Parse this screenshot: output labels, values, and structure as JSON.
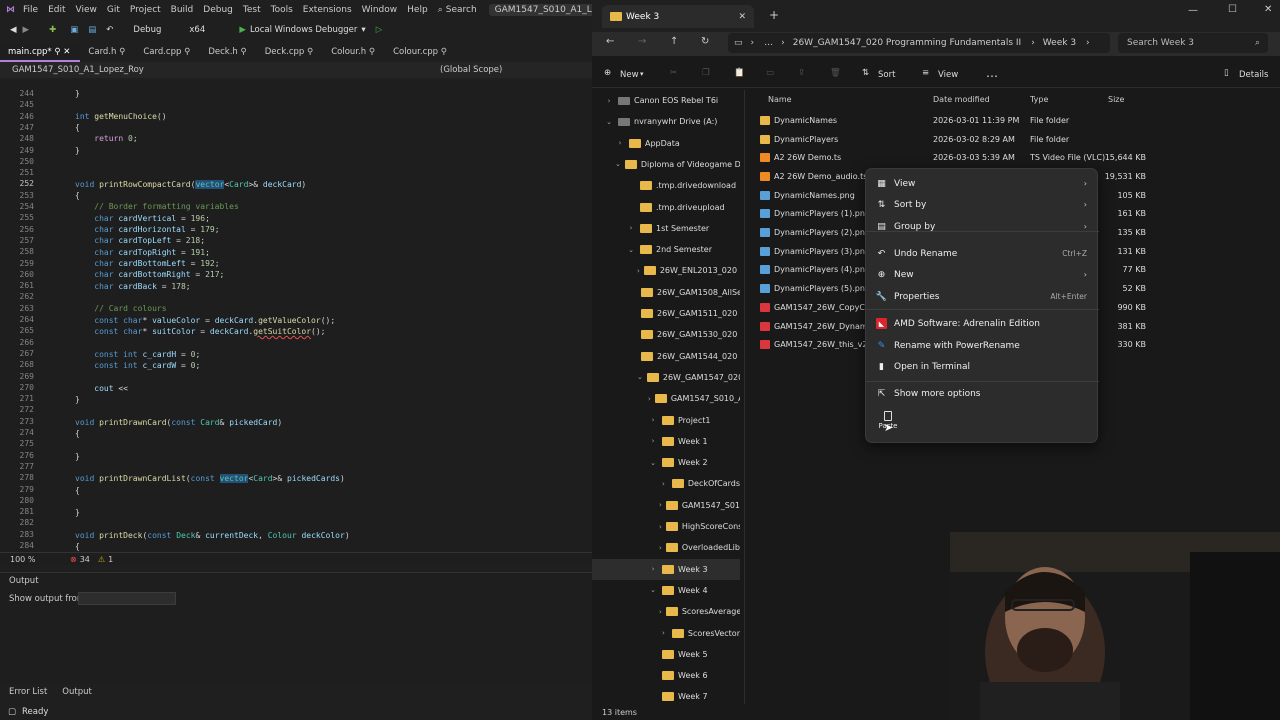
{
  "vs": {
    "menu": [
      "File",
      "Edit",
      "View",
      "Git",
      "Project",
      "Build",
      "Debug",
      "Test",
      "Tools",
      "Extensions",
      "Window",
      "Help"
    ],
    "search_label": "Search",
    "solution_name": "GAM1547_S010_A1_Lopez_Roy",
    "config": "Debug",
    "platform": "x64",
    "run_label": "Local Windows Debugger",
    "tabs": [
      "main.cpp*",
      "Card.h",
      "Card.cpp",
      "Deck.h",
      "Deck.cpp",
      "Colour.h",
      "Colour.cpp"
    ],
    "nav_project": "GAM1547_S010_A1_Lopez_Roy",
    "nav_scope": "(Global Scope)",
    "line_numbers": [
      "244",
      "245",
      "246",
      "247",
      "248",
      "249",
      "250",
      "251",
      "252",
      "253",
      "254",
      "255",
      "256",
      "257",
      "258",
      "259",
      "260",
      "261",
      "262",
      "263",
      "264",
      "265",
      "266",
      "267",
      "268",
      "269",
      "270",
      "271",
      "272",
      "273",
      "274",
      "275",
      "276",
      "277",
      "278",
      "279",
      "280",
      "281",
      "282",
      "283",
      "284"
    ],
    "zoom": "100 %",
    "errors": "34",
    "warnings": "1",
    "output_title": "Output",
    "output_from_label": "Show output from:",
    "bottom_tabs": [
      "Error List",
      "Output"
    ],
    "status": "Ready"
  },
  "explorer": {
    "tab_title": "Week 3",
    "breadcrumb": [
      "26W_GAM1547_020 Programming Fundamentals II",
      "Week 3"
    ],
    "search_placeholder": "Search Week 3",
    "new_label": "New",
    "sort_label": "Sort",
    "view_label": "View",
    "details_label": "Details",
    "columns": [
      "Name",
      "Date modified",
      "Type",
      "Size"
    ],
    "tree": [
      {
        "label": "Canon EOS Rebel T6i",
        "indent": 0,
        "kind": "drive",
        "chev": ">"
      },
      {
        "label": "nvranywhr Drive (A:)",
        "indent": 0,
        "kind": "drive",
        "chev": "v"
      },
      {
        "label": "AppData",
        "indent": 1,
        "kind": "folder",
        "chev": ">"
      },
      {
        "label": "Diploma of Videogame De",
        "indent": 1,
        "kind": "folder",
        "chev": "v"
      },
      {
        "label": ".tmp.drivedownload",
        "indent": 2,
        "kind": "folder",
        "chev": ""
      },
      {
        "label": ".tmp.driveupload",
        "indent": 2,
        "kind": "folder",
        "chev": ""
      },
      {
        "label": "1st Semester",
        "indent": 2,
        "kind": "folder",
        "chev": ">"
      },
      {
        "label": "2nd Semester",
        "indent": 2,
        "kind": "folder",
        "chev": "v"
      },
      {
        "label": "26W_ENL2013_020 Com",
        "indent": 3,
        "kind": "folder",
        "chev": ">"
      },
      {
        "label": "26W_GAM1508_AllSecti",
        "indent": 3,
        "kind": "folder",
        "chev": ""
      },
      {
        "label": "26W_GAM1511_020 Inte",
        "indent": 3,
        "kind": "folder",
        "chev": ""
      },
      {
        "label": "26W_GAM1530_020 Psy",
        "indent": 3,
        "kind": "folder",
        "chev": ""
      },
      {
        "label": "26W_GAM1544_020 Gan",
        "indent": 3,
        "kind": "folder",
        "chev": ""
      },
      {
        "label": "26W_GAM1547_020 Pro",
        "indent": 3,
        "kind": "folder",
        "chev": "v"
      },
      {
        "label": "GAM1547_S010_A1_Lo",
        "indent": 4,
        "kind": "folder",
        "chev": ">"
      },
      {
        "label": "Project1",
        "indent": 4,
        "kind": "folder",
        "chev": ">"
      },
      {
        "label": "Week 1",
        "indent": 4,
        "kind": "folder",
        "chev": ">"
      },
      {
        "label": "Week 2",
        "indent": 4,
        "kind": "folder",
        "chev": "v"
      },
      {
        "label": "DeckOfCards",
        "indent": 5,
        "kind": "folder",
        "chev": ">"
      },
      {
        "label": "GAM1547_S010_A1_L",
        "indent": 5,
        "kind": "folder",
        "chev": ">"
      },
      {
        "label": "HighScoreConstruct",
        "indent": 5,
        "kind": "folder",
        "chev": ">"
      },
      {
        "label": "OverloadedLibrary",
        "indent": 5,
        "kind": "folder",
        "chev": ">"
      },
      {
        "label": "Week 3",
        "indent": 4,
        "kind": "folder",
        "chev": ">",
        "selected": true
      },
      {
        "label": "Week 4",
        "indent": 4,
        "kind": "folder",
        "chev": "v"
      },
      {
        "label": "ScoresAverage",
        "indent": 5,
        "kind": "folder",
        "chev": ">"
      },
      {
        "label": "ScoresVector",
        "indent": 5,
        "kind": "folder",
        "chev": ">"
      },
      {
        "label": "Week 5",
        "indent": 4,
        "kind": "folder",
        "chev": ""
      },
      {
        "label": "Week 6",
        "indent": 4,
        "kind": "folder",
        "chev": ""
      },
      {
        "label": "Week 7",
        "indent": 4,
        "kind": "folder",
        "chev": ""
      }
    ],
    "files": [
      {
        "name": "DynamicNames",
        "date": "2026-03-01 11:39 PM",
        "type": "File folder",
        "size": "",
        "icon": "folder"
      },
      {
        "name": "DynamicPlayers",
        "date": "2026-03-02 8:29 AM",
        "type": "File folder",
        "size": "",
        "icon": "folder"
      },
      {
        "name": "A2 26W Demo.ts",
        "date": "2026-03-03 5:39 AM",
        "type": "TS Video File (VLC)",
        "size": "15,644 KB",
        "icon": "video"
      },
      {
        "name": "A2 26W Demo_audio.ts",
        "date": "",
        "type": "",
        "size": "19,531 KB",
        "icon": "video"
      },
      {
        "name": "DynamicNames.png",
        "date": "",
        "type": "",
        "size": "105 KB",
        "icon": "image"
      },
      {
        "name": "DynamicPlayers (1).png",
        "date": "",
        "type": "",
        "size": "161 KB",
        "icon": "image"
      },
      {
        "name": "DynamicPlayers (2).png",
        "date": "",
        "type": "",
        "size": "135 KB",
        "icon": "image"
      },
      {
        "name": "DynamicPlayers (3).png",
        "date": "",
        "type": "",
        "size": "131 KB",
        "icon": "image"
      },
      {
        "name": "DynamicPlayers (4).png",
        "date": "",
        "type": "",
        "size": "77 KB",
        "icon": "image"
      },
      {
        "name": "DynamicPlayers (5).png",
        "date": "",
        "type": "",
        "size": "52 KB",
        "icon": "image"
      },
      {
        "name": "GAM1547_26W_CopyCons",
        "date": "",
        "type": "",
        "size": "990 KB",
        "icon": "pdf"
      },
      {
        "name": "GAM1547_26W_Dynamica",
        "date": "",
        "type": "",
        "size": "381 KB",
        "icon": "pdf"
      },
      {
        "name": "GAM1547_26W_this_v2.pd",
        "date": "",
        "type": "",
        "size": "330 KB",
        "icon": "pdf"
      }
    ],
    "item_count": "13 items"
  },
  "context_menu": {
    "items": [
      {
        "label": "View",
        "shortcut": "",
        "submenu": true,
        "icon": "view-icon"
      },
      {
        "label": "Sort by",
        "shortcut": "",
        "submenu": true,
        "icon": "sort-icon"
      },
      {
        "label": "Group by",
        "shortcut": "",
        "submenu": true,
        "icon": "group-icon"
      },
      {
        "label": "Undo Rename",
        "shortcut": "Ctrl+Z",
        "submenu": false,
        "icon": "undo-icon"
      },
      {
        "label": "New",
        "shortcut": "",
        "submenu": true,
        "icon": "new-icon"
      },
      {
        "label": "Properties",
        "shortcut": "Alt+Enter",
        "submenu": false,
        "icon": "properties-icon"
      },
      {
        "label": "AMD Software: Adrenalin Edition",
        "shortcut": "",
        "submenu": false,
        "icon": "amd-icon"
      },
      {
        "label": "Rename with PowerRename",
        "shortcut": "",
        "submenu": false,
        "icon": "powerrename-icon"
      },
      {
        "label": "Open in Terminal",
        "shortcut": "",
        "submenu": false,
        "icon": "terminal-icon"
      },
      {
        "label": "Show more options",
        "shortcut": "",
        "submenu": false,
        "icon": "more-options-icon"
      }
    ],
    "paste_label": "Paste"
  }
}
